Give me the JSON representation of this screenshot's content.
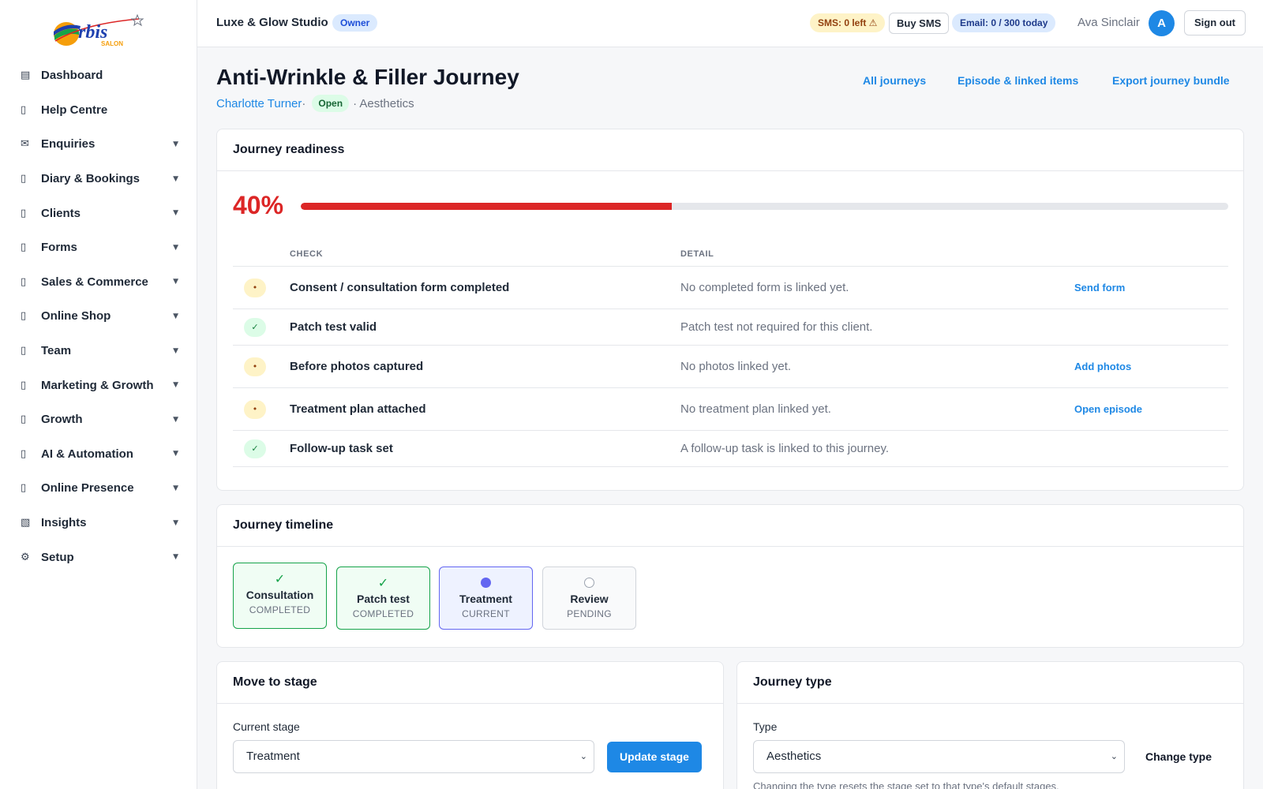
{
  "brand": {
    "logo_text": "rbis",
    "logo_sub": "SALON"
  },
  "sidebar": {
    "items": [
      {
        "label": "Dashboard",
        "icon": "▤",
        "icon_name": "dashboard-icon",
        "has_caret": false
      },
      {
        "label": "Help Centre",
        "icon": "▯",
        "icon_name": "help-icon",
        "has_caret": false
      },
      {
        "label": "Enquiries",
        "icon": "✉",
        "icon_name": "mail-icon",
        "has_caret": true
      },
      {
        "label": "Diary & Bookings",
        "icon": "▯",
        "icon_name": "calendar-icon",
        "has_caret": true
      },
      {
        "label": "Clients",
        "icon": "▯",
        "icon_name": "clients-icon",
        "has_caret": true
      },
      {
        "label": "Forms",
        "icon": "▯",
        "icon_name": "forms-icon",
        "has_caret": true
      },
      {
        "label": "Sales & Commerce",
        "icon": "▯",
        "icon_name": "sales-icon",
        "has_caret": true
      },
      {
        "label": "Online Shop",
        "icon": "▯",
        "icon_name": "shop-icon",
        "has_caret": true
      },
      {
        "label": "Team",
        "icon": "▯",
        "icon_name": "team-icon",
        "has_caret": true
      },
      {
        "label": "Marketing & Growth",
        "icon": "▯",
        "icon_name": "marketing-icon",
        "has_caret": true
      },
      {
        "label": "Growth",
        "icon": "▯",
        "icon_name": "growth-icon",
        "has_caret": true
      },
      {
        "label": "AI & Automation",
        "icon": "▯",
        "icon_name": "ai-icon",
        "has_caret": true
      },
      {
        "label": "Online Presence",
        "icon": "▯",
        "icon_name": "presence-icon",
        "has_caret": true
      },
      {
        "label": "Insights",
        "icon": "▧",
        "icon_name": "insights-icon",
        "has_caret": true
      },
      {
        "label": "Setup",
        "icon": "⚙",
        "icon_name": "gear-icon",
        "has_caret": true
      }
    ],
    "caret": "▼"
  },
  "topbar": {
    "studio": "Luxe & Glow Studio",
    "role": "Owner",
    "sms": "SMS: 0 left ⚠",
    "buy_sms": "Buy SMS",
    "email": "Email: 0 / 300 today",
    "user": "Ava Sinclair",
    "avatar": "A",
    "sign_out": "Sign out"
  },
  "header": {
    "title": "Anti-Wrinkle & Filler Journey",
    "client": "Charlotte Turner",
    "sep1": " ·",
    "status": "Open",
    "category": "· Aesthetics",
    "links": [
      "All journeys",
      "Episode & linked items",
      "Export journey bundle"
    ]
  },
  "readiness": {
    "title": "Journey readiness",
    "percent_label": "40%",
    "percent": 40,
    "columns": {
      "check": "CHECK",
      "detail": "DETAIL"
    },
    "rows": [
      {
        "status": "pending",
        "glyph": "•",
        "check": "Consent / consultation form completed",
        "detail": "No completed form is linked yet.",
        "action": "Send form"
      },
      {
        "status": "ok",
        "glyph": "✓",
        "check": "Patch test valid",
        "detail": "Patch test not required for this client.",
        "action": ""
      },
      {
        "status": "pending",
        "glyph": "•",
        "check": "Before photos captured",
        "detail": "No photos linked yet.",
        "action": "Add photos"
      },
      {
        "status": "pending",
        "glyph": "•",
        "check": "Treatment plan attached",
        "detail": "No treatment plan linked yet.",
        "action": "Open episode"
      },
      {
        "status": "ok",
        "glyph": "✓",
        "check": "Follow-up task set",
        "detail": "A follow-up task is linked to this journey.",
        "action": ""
      }
    ]
  },
  "timeline": {
    "title": "Journey timeline",
    "stages": [
      {
        "name": "Consultation",
        "state": "COMPLETED",
        "kind": "completed",
        "mark": "✓"
      },
      {
        "name": "Patch test",
        "state": "COMPLETED",
        "kind": "completed",
        "mark": "✓"
      },
      {
        "name": "Treatment",
        "state": "CURRENT",
        "kind": "current",
        "mark": ""
      },
      {
        "name": "Review",
        "state": "PENDING",
        "kind": "pending",
        "mark": ""
      }
    ]
  },
  "move_stage": {
    "title": "Move to stage",
    "label": "Current stage",
    "value": "Treatment",
    "button": "Update stage"
  },
  "journey_type": {
    "title": "Journey type",
    "label": "Type",
    "value": "Aesthetics",
    "button": "Change type",
    "help": "Changing the type resets the stage set to that type's default stages."
  },
  "colors": {
    "accent": "#1e88e5",
    "danger": "#dc2626",
    "success": "#16a34a",
    "current": "#6366f1"
  }
}
